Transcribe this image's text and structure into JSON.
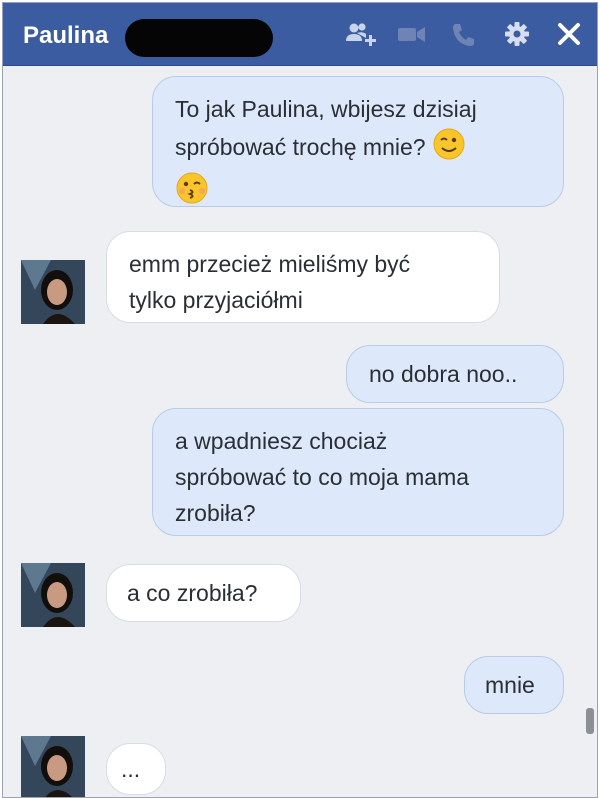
{
  "header": {
    "contact_name": "Paulina",
    "icons": [
      "add-person-icon",
      "video-call-icon",
      "phone-icon",
      "gear-icon",
      "close-icon"
    ],
    "color": "#3b5ca0"
  },
  "messages": [
    {
      "direction": "outgoing",
      "text_line1": "To jak Paulina, wbijesz dzisiaj",
      "text_line2": "spróbować trochę mnie?",
      "emojis": [
        "winking-face-emoji",
        "kissing-face-emoji"
      ]
    },
    {
      "direction": "incoming",
      "text_line1": "emm przecież mieliśmy być",
      "text_line2": "tylko przyjaciółmi"
    },
    {
      "direction": "outgoing",
      "text": "no dobra noo.."
    },
    {
      "direction": "outgoing",
      "text_line1": "a wpadniesz chociaż",
      "text_line2": "spróbować to co moja mama",
      "text_line3": "zrobiła?"
    },
    {
      "direction": "incoming",
      "text": "a co zrobiła?"
    },
    {
      "direction": "outgoing",
      "text": "mnie"
    },
    {
      "direction": "incoming",
      "text": "..."
    }
  ],
  "colors": {
    "outgoing_bubble": "#dde9fb",
    "incoming_bubble": "#ffffff",
    "chat_background": "#edeff3"
  }
}
